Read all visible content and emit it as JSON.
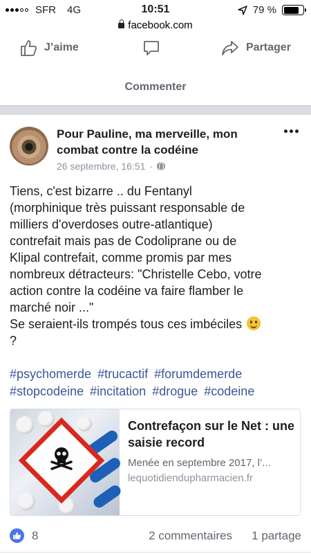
{
  "status_bar": {
    "carrier": "SFR",
    "network": "4G",
    "time": "10:51",
    "battery": "79 %",
    "battery_level": 0.79
  },
  "browser": {
    "url": "facebook.com"
  },
  "action_bar": {
    "like_label": "J’aime",
    "share_label": "Partager",
    "comment_label": "Commenter"
  },
  "post": {
    "page_name": "Pour Pauline, ma merveille, mon combat contre la codéine",
    "timestamp": "26 septembre, 16:51",
    "separator": "·",
    "text_lines": [
      "Tiens, c'est bizarre .. du Fentanyl",
      "(morphinique très puissant responsable de",
      "milliers d'overdoses outre-atlantique)",
      "contrefait mais pas de Codoliprane ou de",
      "Klipal contrefait, comme promis par mes",
      "nombreux détracteurs: \"Christelle Cebo, votre",
      "action contre la codéine va faire flamber le",
      "marché noir ...\"",
      "Se seraient-ils trompés tous ces imbéciles",
      "?"
    ],
    "hashtags": [
      "#psychomerde",
      "#trucactif",
      "#forumdemerde",
      "#stopcodeine",
      "#incitation",
      "#drogue",
      "#codeine"
    ],
    "link_card": {
      "title": "Contrefaçon sur le Net : une saisie record",
      "description": "Menée en septembre 2017, l’...",
      "domain": "lequotidiendupharmacien.fr"
    },
    "reactions_count": "8",
    "comments_count": "2 commentaires",
    "shares_count": "1 partage"
  },
  "colors": {
    "link_blue": "#385898",
    "meta_gray": "#8d949e",
    "action_gray": "#606770",
    "like_blue": "#4a76e8",
    "hazard_red": "#d9281e"
  }
}
